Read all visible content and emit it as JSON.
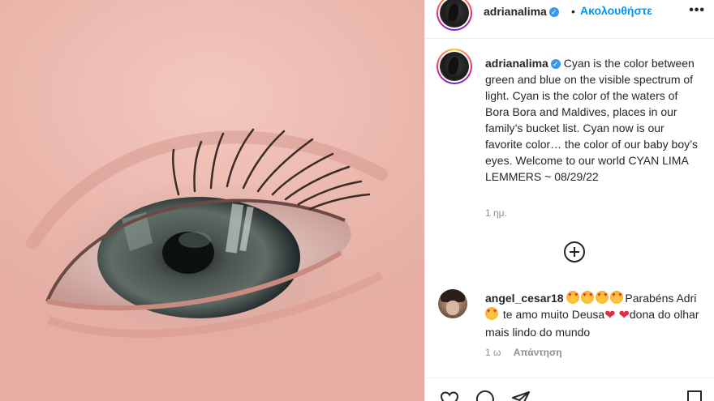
{
  "post": {
    "username": "adrianalima",
    "follow_label": "Ακολουθήστε",
    "more_label": "•••",
    "separator": "•",
    "verified_mark": "✓"
  },
  "caption": {
    "username": "adrianalima",
    "text": "Cyan is the color between green and blue on the visible spectrum of light. Cyan is the color of the waters of Bora Bora and Maldives, places in our family’s bucket list. Cyan now is our favorite color… the color of our baby boy’s eyes. Welcome to our world CYAN LIMA LEMMERS ~ 08/29/22",
    "time": "1 ημ."
  },
  "comment": {
    "username": "angel_cesar18",
    "text_part1": "Parabéns Adri",
    "text_part2": " te amo muito Deusa",
    "text_part3": "dona do olhar mais lindo do mundo",
    "heart_glyph": "❤",
    "time": "1 ω",
    "reply_label": "Απάντηση"
  },
  "icons": {
    "verified": "verified-badge-icon",
    "add_comment": "plus-circle-icon",
    "like": "heart-icon",
    "comment": "speech-bubble-icon",
    "share": "paper-plane-icon",
    "save": "bookmark-icon",
    "more": "ellipsis-icon"
  },
  "colors": {
    "link_blue": "#0095f6",
    "verified_blue": "#3897f0",
    "muted_text": "#8e8e8e",
    "primary_text": "#262626"
  }
}
